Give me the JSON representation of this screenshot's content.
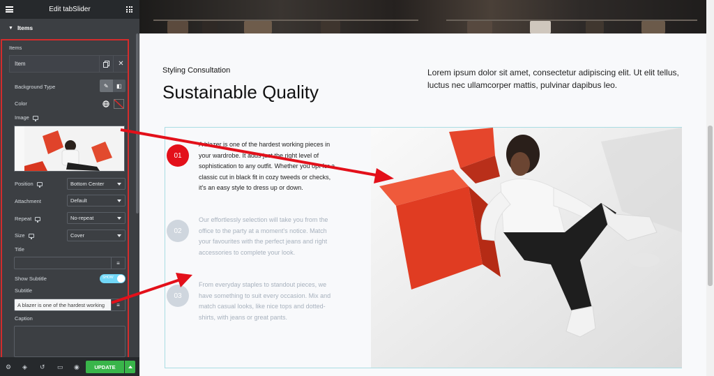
{
  "panel": {
    "header_title": "Edit tabSlider",
    "section_title": "Items",
    "items_label": "Items",
    "item_title": "Item",
    "labels": {
      "background_type": "Background Type",
      "color": "Color",
      "image": "Image",
      "position": "Position",
      "attachment": "Attachment",
      "repeat": "Repeat",
      "size": "Size",
      "title": "Title",
      "show_subtitle": "Show Subtitle",
      "subtitle": "Subtitle",
      "caption": "Caption"
    },
    "selects": {
      "position": "Bottom Center",
      "attachment": "Default",
      "repeat": "No-repeat",
      "size": "Cover"
    },
    "title_value": "",
    "subtitle_value": "A blazer is one of the hardest working",
    "toggle_text": "SHOW",
    "toggle_on": true,
    "update_label": "UPDATE",
    "colors": {
      "accent_green": "#39b54a",
      "highlight_red": "#d42c2c",
      "toggle_blue": "#71d7f7"
    }
  },
  "preview": {
    "subheading": "Styling Consultation",
    "heading": "Sustainable Quality",
    "intro": "Lorem ipsum dolor sit amet, consectetur adipiscing elit. Ut elit tellus, luctus nec ullamcorper mattis, pulvinar dapibus leo.",
    "tabs": [
      {
        "number": "01",
        "text": "A blazer is one of the hardest working pieces in your wardrobe. It adds just the right level of sophistication to any outfit. Whether you opt for a classic cut in black fit in cozy tweeds or checks, it's an easy style to dress up or down.",
        "active": true
      },
      {
        "number": "02",
        "text": "Our effortlessly selection will take you from the office to the party at a moment's notice. Match your favourites with the perfect jeans and right accessories to complete your look.",
        "active": false
      },
      {
        "number": "03",
        "text": "From everyday staples to standout pieces, we have something to suit every occasion. Mix and match casual looks, like nice tops and dotted-shirts, with jeans or great pants.",
        "active": false
      }
    ],
    "colors": {
      "active_tab": "#e3101a",
      "inactive_tab": "#cfd6de",
      "box_border": "#a9dde3"
    }
  }
}
